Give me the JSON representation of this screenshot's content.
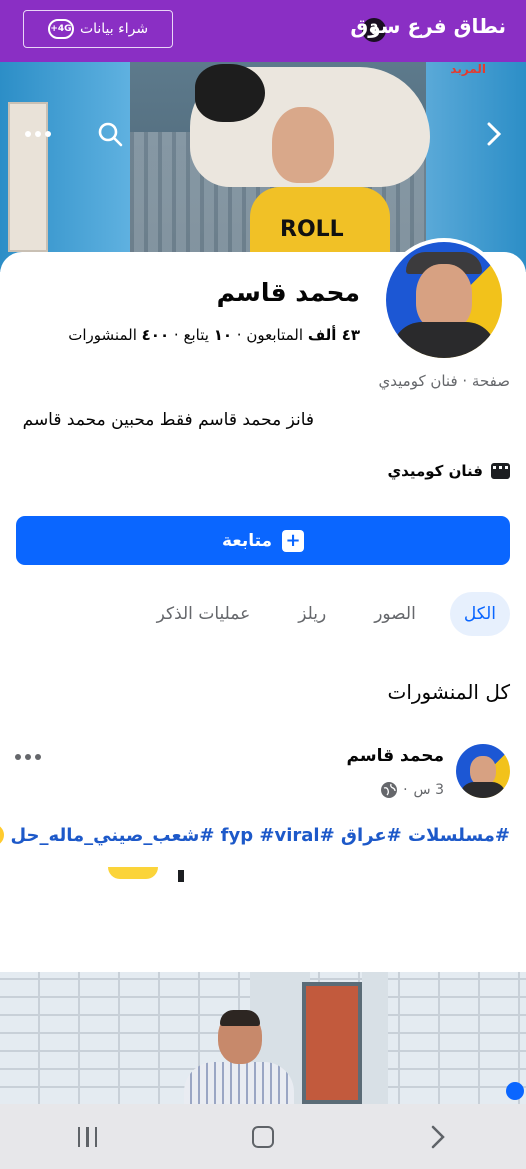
{
  "promo": {
    "buy_data_label": "شراء بيانات",
    "network_badge": "4G+",
    "brand_name": "نطاق فرع سوق",
    "help_icon": "question-icon"
  },
  "cover": {
    "watermark": "المربد",
    "shirt_text": "ROLL",
    "back_icon": "chevron-right-icon",
    "search_icon": "search-icon",
    "more_icon": "more-horiz-icon"
  },
  "profile": {
    "name": "محمد قاسم",
    "followers_count": "٤٣ ألف",
    "followers_label": "المتابعون",
    "following_count": "١٠",
    "following_label": "يتابع",
    "posts_count": "٤٠٠",
    "posts_label": "المنشورات",
    "separator": "·",
    "category": "صفحة · فنان كوميدي",
    "bio": "فانز محمد قاسم فقط محبين محمد قاسم",
    "detail": "فنان كوميدي",
    "follow_button": "متابعة"
  },
  "tabs": [
    {
      "label": "الكل",
      "active": true
    },
    {
      "label": "الصور",
      "active": false
    },
    {
      "label": "ريلز",
      "active": false
    },
    {
      "label": "عمليات الذكر",
      "active": false
    }
  ],
  "feed": {
    "section_title": "كل المنشورات",
    "post": {
      "author": "محمد قاسم",
      "time": "3 س",
      "hashtags": "#مسلسلات #عراق #fyp #viral #شعب_صيني_ماله_حل"
    }
  },
  "colors": {
    "promo_bg": "#8a2fc4",
    "accent": "#0a66ff",
    "hashtag": "#1d59c9"
  }
}
